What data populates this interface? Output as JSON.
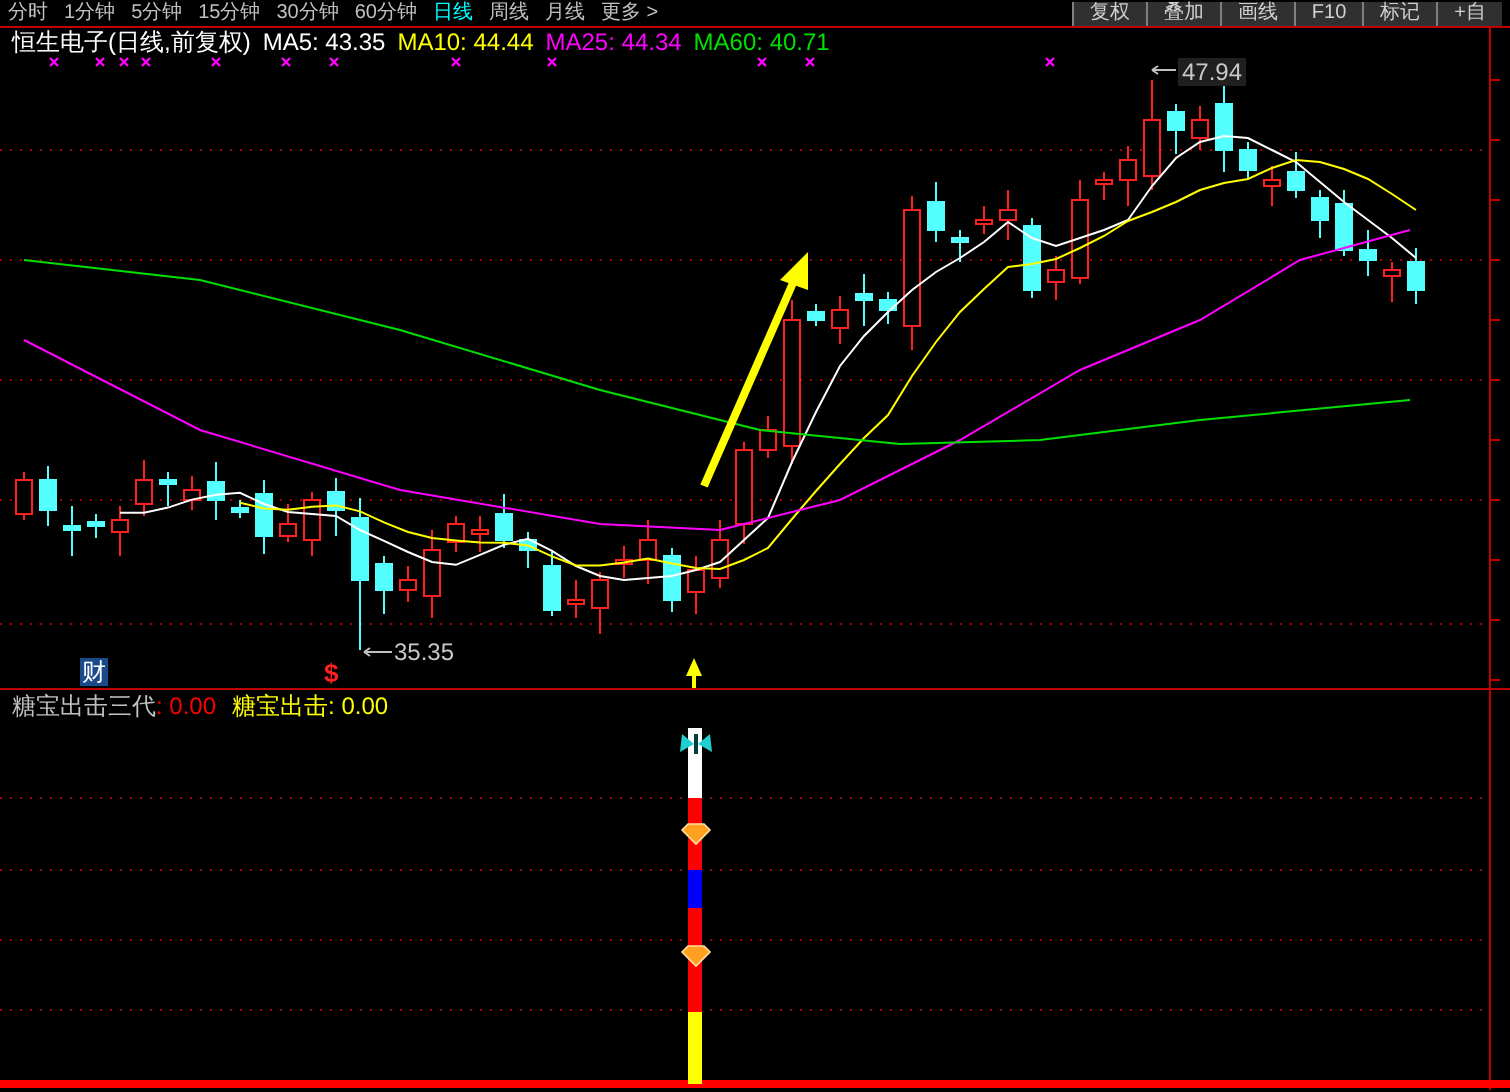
{
  "toolbar": {
    "periods": [
      {
        "label": "分时",
        "selected": false
      },
      {
        "label": "1分钟",
        "selected": false
      },
      {
        "label": "5分钟",
        "selected": false
      },
      {
        "label": "15分钟",
        "selected": false
      },
      {
        "label": "30分钟",
        "selected": false
      },
      {
        "label": "60分钟",
        "selected": false
      },
      {
        "label": "日线",
        "selected": true
      },
      {
        "label": "周线",
        "selected": false
      },
      {
        "label": "月线",
        "selected": false
      },
      {
        "label": "更多 >",
        "selected": false
      }
    ],
    "buttons": [
      "复权",
      "叠加",
      "画线",
      "F10",
      "标记",
      "+自"
    ]
  },
  "price_chart": {
    "legend": {
      "title": "恒生电子(日线,前复权)",
      "averages": [
        {
          "label": "MA5: 43.35",
          "color": "#ffffff"
        },
        {
          "label": "MA10: 44.44",
          "color": "#ffff00"
        },
        {
          "label": "MA25: 44.34",
          "color": "#ff00ff"
        },
        {
          "label": "MA60: 40.71",
          "color": "#00e000"
        }
      ]
    },
    "high_label": "47.94",
    "low_label": "35.35",
    "badges": [
      {
        "kind": "finance",
        "text": "财"
      },
      {
        "kind": "signal",
        "text": "$"
      }
    ]
  },
  "indicator_panel": {
    "legend": [
      {
        "text": "糖宝出击三代",
        "color": "#c0c0c0"
      },
      {
        "text": ": 0.00",
        "color": "#ff0000"
      },
      {
        "text": "糖宝出击:",
        "color": "#ffff00"
      },
      {
        "text": " 0.00",
        "color": "#ffff00"
      }
    ]
  }
}
